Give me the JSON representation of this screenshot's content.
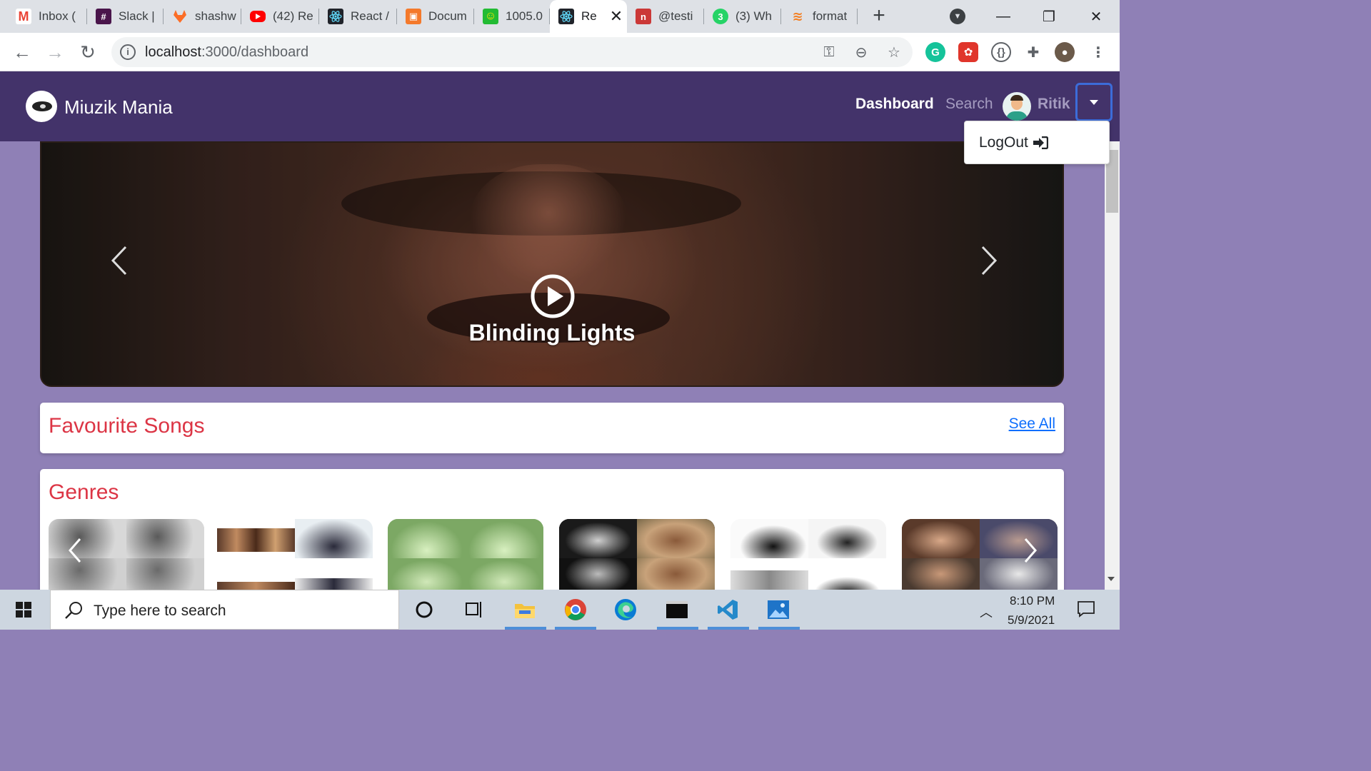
{
  "browser": {
    "tabs": [
      {
        "title": "Inbox (",
        "icon": "gmail-icon",
        "color": "#ea4335"
      },
      {
        "title": "Slack |",
        "icon": "slack-icon",
        "color": "#4a154b"
      },
      {
        "title": "shashw",
        "icon": "gitlab-icon",
        "color": "#fc6d26"
      },
      {
        "title": "(42) Re",
        "icon": "youtube-icon",
        "color": "#ff0000"
      },
      {
        "title": "React /",
        "icon": "react-icon",
        "color": "#20232a"
      },
      {
        "title": "Docum",
        "icon": "docs-icon",
        "color": "#f4792b"
      },
      {
        "title": "1005.0",
        "icon": "smiley-icon",
        "color": "#22bb33"
      },
      {
        "title": "Re",
        "icon": "react-icon",
        "color": "#20232a"
      },
      {
        "title": "@testi",
        "icon": "npm-icon",
        "color": "#cb3837"
      },
      {
        "title": "(3) Wh",
        "icon": "whatsapp-icon",
        "color": "#25d366"
      },
      {
        "title": "format",
        "icon": "stackoverflow-icon",
        "color": "#f48024"
      }
    ],
    "active_tab_index": 7,
    "url_host": "localhost",
    "url_path": ":3000/dashboard"
  },
  "app": {
    "brand": "Miuzik Mania",
    "nav": {
      "dashboard": "Dashboard",
      "search": "Search",
      "user": "Ritik"
    },
    "dropdown": {
      "logout": "LogOut"
    },
    "carousel": {
      "title": "Blinding Lights"
    },
    "favourites": {
      "title": "Favourite Songs",
      "see_all": "See All"
    },
    "genres": {
      "title": "Genres"
    }
  },
  "taskbar": {
    "search_placeholder": "Type here to search",
    "time": "8:10 PM",
    "date": "5/9/2021"
  },
  "colors": {
    "navbar": "#43336a",
    "page_bg": "#8f80b6",
    "card_title": "#dc3545",
    "link": "#0d6efd"
  }
}
